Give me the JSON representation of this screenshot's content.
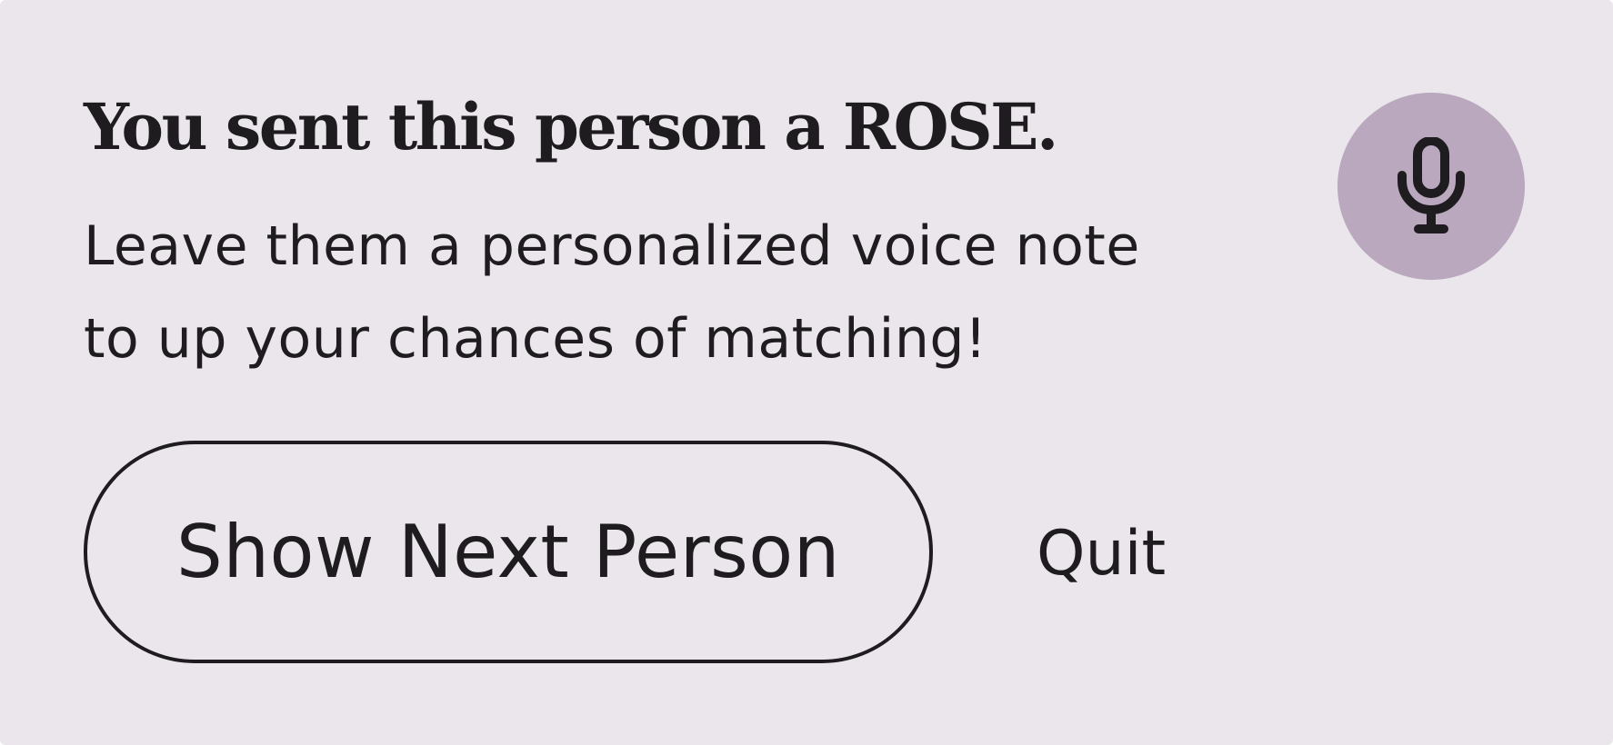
{
  "card": {
    "title": "You sent this person a ROSE.",
    "body_lines": [
      "Leave them a personalized voice note",
      "to up your chances of matching!"
    ],
    "mic_icon": "microphone-icon",
    "next_button_label": "Show Next Person",
    "quit_label": "Quit"
  },
  "colors": {
    "background": "#eae6eb",
    "text": "#1e1c1f",
    "mic_circle": "#b9a8be"
  }
}
